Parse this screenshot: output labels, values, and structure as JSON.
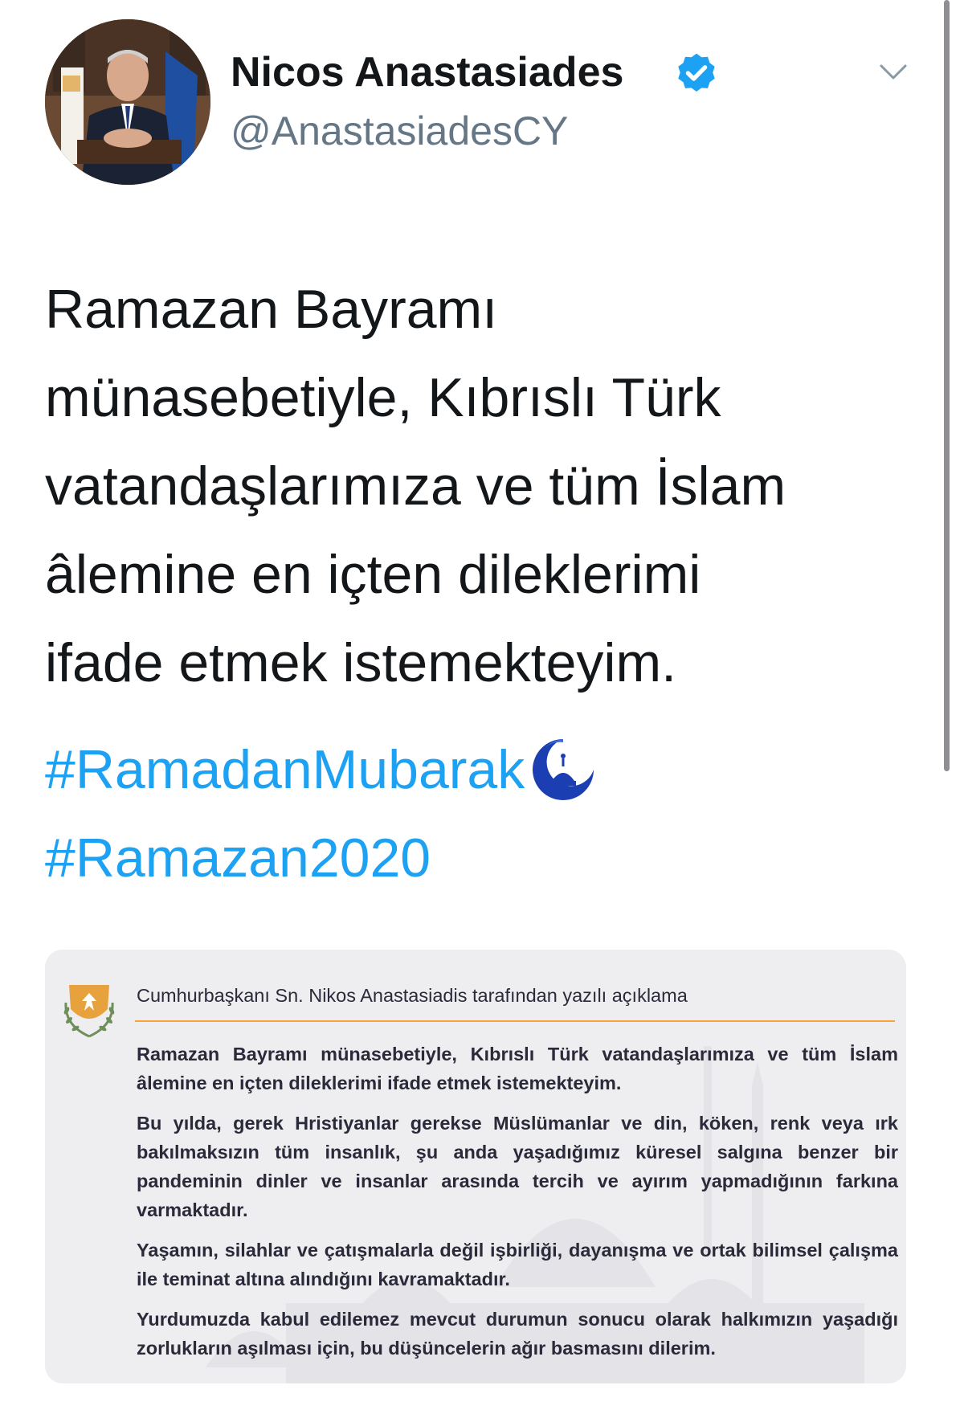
{
  "tweet": {
    "author_name": "Nicos Anastasiades",
    "handle": "@AnastasiadesCY",
    "verified_color": "#1da1f2",
    "text_lines": [
      "Ramazan Bayramı",
      "münasebetiyle, Kıbrıslı Türk",
      "vatandaşlarımıza ve tüm İslam",
      "âlemine en içten dileklerimi",
      "ifade etmek istemekteyim."
    ],
    "hashtags": [
      "#RamadanMubarak",
      "#Ramazan2020"
    ],
    "hashtag_color": "#1da1f2"
  },
  "icons": {
    "verified": "verified-badge-icon",
    "menu": "chevron-down-icon",
    "emoji": "crescent-moon-mosque-icon",
    "emblem": "cyprus-coat-of-arms-icon"
  },
  "statement": {
    "title": "Cumhurbaşkanı Sn. Nikos Anastasiadis tarafından yazılı açıklama",
    "accent_color": "#f2a33a",
    "paragraphs": [
      "Ramazan Bayramı münasebetiyle, Kıbrıslı Türk vatandaşlarımıza ve tüm İslam âlemine en içten dileklerimi ifade etmek istemekteyim.",
      "Bu yılda, gerek Hristiyanlar gerekse Müslümanlar ve din, köken, renk veya ırk bakılmaksızın tüm insanlık, şu anda yaşadığımız küresel salgına benzer bir pandeminin dinler ve insanlar arasında tercih ve ayırım yapmadığının farkına varmaktadır.",
      "Yaşamın, silahlar ve çatışmalarla değil işbirliği, dayanışma ve ortak bilimsel çalışma ile teminat altına alındığını kavramaktadır.",
      "Yurdumuzda kabul edilemez mevcut durumun sonucu olarak halkımızın yaşadığı zorlukların aşılması için, bu düşüncelerin ağır basmasını dilerim."
    ]
  }
}
